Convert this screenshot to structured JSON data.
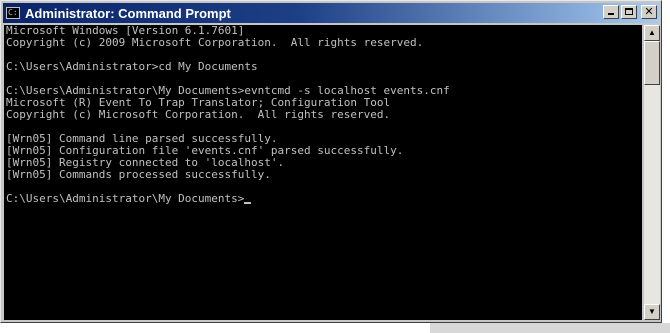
{
  "window": {
    "title": "Administrator: Command Prompt",
    "icon": "command-prompt-icon"
  },
  "console": {
    "lines": [
      "Microsoft Windows [Version 6.1.7601]",
      "Copyright (c) 2009 Microsoft Corporation.  All rights reserved.",
      "",
      "C:\\Users\\Administrator>cd My Documents",
      "",
      "C:\\Users\\Administrator\\My Documents>evntcmd -s localhost events.cnf",
      "Microsoft (R) Event To Trap Translator; Configuration Tool",
      "Copyright (c) Microsoft Corporation.  All rights reserved.",
      "",
      "[Wrn05] Command line parsed successfully.",
      "[Wrn05] Configuration file 'events.cnf' parsed successfully.",
      "[Wrn05] Registry connected to 'localhost'.",
      "[Wrn05] Commands processed successfully.",
      "",
      "C:\\Users\\Administrator\\My Documents>"
    ]
  },
  "colors": {
    "console_bg": "#000000",
    "console_fg": "#c0c0c0",
    "titlebar_start": "#0a246a",
    "titlebar_end": "#a6caf0"
  }
}
